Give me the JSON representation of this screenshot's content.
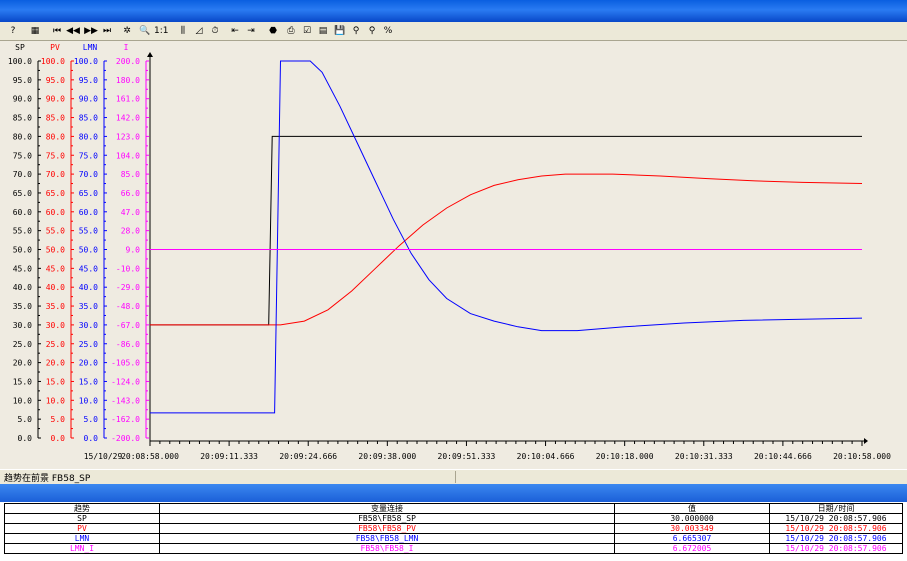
{
  "toolbar": {
    "buttons": [
      {
        "name": "help-button",
        "glyph": "?"
      },
      {
        "name": "properties-button",
        "glyph": "▦"
      },
      {
        "name": "first-button",
        "glyph": "⏮"
      },
      {
        "name": "prev-button",
        "glyph": "◀◀"
      },
      {
        "name": "next-button",
        "glyph": "▶▶"
      },
      {
        "name": "last-button",
        "glyph": "⏭"
      },
      {
        "name": "pause-button",
        "glyph": "✲"
      },
      {
        "name": "zoom-button",
        "glyph": "🔍"
      },
      {
        "name": "original-size-button",
        "glyph": "1:1"
      },
      {
        "name": "ruler-button",
        "glyph": "⫼"
      },
      {
        "name": "zoom-area-button",
        "glyph": "◿"
      },
      {
        "name": "reset-button",
        "glyph": "⏱"
      },
      {
        "name": "select-trend-button",
        "glyph": "⇤"
      },
      {
        "name": "export-button",
        "glyph": "⇥"
      },
      {
        "name": "start-button",
        "glyph": "⬣"
      },
      {
        "name": "print-button",
        "glyph": "⎙"
      },
      {
        "name": "config-button",
        "glyph": "☑"
      },
      {
        "name": "stats-button",
        "glyph": "▤"
      },
      {
        "name": "save-button",
        "glyph": "💾"
      },
      {
        "name": "connect-button",
        "glyph": "⚲"
      },
      {
        "name": "connect2-button",
        "glyph": "⚲"
      },
      {
        "name": "percent-button",
        "glyph": "%"
      }
    ]
  },
  "axes": {
    "headers": [
      "SP",
      "PV",
      "LMN",
      "I"
    ],
    "sp_ticks": [
      "100.0",
      "95.0",
      "90.0",
      "85.0",
      "80.0",
      "75.0",
      "70.0",
      "65.0",
      "60.0",
      "55.0",
      "50.0",
      "45.0",
      "40.0",
      "35.0",
      "30.0",
      "25.0",
      "20.0",
      "15.0",
      "10.0",
      "5.0",
      "0.0"
    ],
    "pv_ticks": [
      "100.0",
      "95.0",
      "90.0",
      "85.0",
      "80.0",
      "75.0",
      "70.0",
      "65.0",
      "60.0",
      "55.0",
      "50.0",
      "45.0",
      "40.0",
      "35.0",
      "30.0",
      "25.0",
      "20.0",
      "15.0",
      "10.0",
      "5.0",
      "0.0"
    ],
    "lmn_ticks": [
      "100.0",
      "95.0",
      "90.0",
      "85.0",
      "80.0",
      "75.0",
      "70.0",
      "65.0",
      "60.0",
      "55.0",
      "50.0",
      "45.0",
      "40.0",
      "35.0",
      "30.0",
      "25.0",
      "20.0",
      "15.0",
      "10.0",
      "5.0",
      "0.0"
    ],
    "i_ticks": [
      "200.0",
      "180.0",
      "161.0",
      "142.0",
      "123.0",
      "104.0",
      "85.0",
      "66.0",
      "47.0",
      "28.0",
      "9.0",
      "-10.0",
      "-29.0",
      "-48.0",
      "-67.0",
      "-86.0",
      "-105.0",
      "-124.0",
      "-143.0",
      "-162.0",
      "-200.0"
    ],
    "x_date": "15/10/29",
    "x_ticks": [
      "20:08:58.000",
      "20:09:11.333",
      "20:09:24.666",
      "20:09:38.000",
      "20:09:51.333",
      "20:10:04.666",
      "20:10:18.000",
      "20:10:31.333",
      "20:10:44.666",
      "20:10:58.000"
    ]
  },
  "colors": {
    "sp": "#000000",
    "pv": "#ff0000",
    "lmn": "#0000ff",
    "i": "#ff00ff"
  },
  "status": {
    "text": "趋势在前景 FB58_SP"
  },
  "table": {
    "headers": [
      "趋势",
      "变量连接",
      "值",
      "日期/时间"
    ],
    "rows": [
      {
        "trend": "SP",
        "var": "FB58\\FB58_SP",
        "value": "30.000000",
        "datetime": "15/10/29 20:08:57.906",
        "color": "#000000"
      },
      {
        "trend": "PV",
        "var": "FB58\\FB58_PV",
        "value": "30.003349",
        "datetime": "15/10/29 20:08:57.906",
        "color": "#ff0000"
      },
      {
        "trend": "LMN",
        "var": "FB58\\FB58_LMN",
        "value": "6.665307",
        "datetime": "15/10/29 20:08:57.906",
        "color": "#0000ff"
      },
      {
        "trend": "LMN_I",
        "var": "FB58\\FB58_I",
        "value": "6.672005",
        "datetime": "15/10/29 20:08:57.906",
        "color": "#ff00ff"
      }
    ]
  },
  "chart_data": {
    "type": "line",
    "x_unit": "seconds",
    "xlim": [
      0,
      120
    ],
    "series": [
      {
        "name": "SP",
        "axis": "sp",
        "points": [
          [
            0,
            30
          ],
          [
            20,
            30
          ],
          [
            20.6,
            80
          ],
          [
            120,
            80
          ]
        ]
      },
      {
        "name": "PV",
        "axis": "pv",
        "points": [
          [
            0,
            30
          ],
          [
            22,
            30
          ],
          [
            26,
            31
          ],
          [
            30,
            34
          ],
          [
            34,
            39
          ],
          [
            38,
            45
          ],
          [
            42,
            51
          ],
          [
            46,
            56.5
          ],
          [
            50,
            61
          ],
          [
            54,
            64.5
          ],
          [
            58,
            67
          ],
          [
            62,
            68.5
          ],
          [
            66,
            69.5
          ],
          [
            70,
            70
          ],
          [
            78,
            70
          ],
          [
            86,
            69.5
          ],
          [
            94,
            68.8
          ],
          [
            102,
            68.2
          ],
          [
            110,
            67.8
          ],
          [
            120,
            67.5
          ]
        ]
      },
      {
        "name": "LMN",
        "axis": "lmn",
        "points": [
          [
            0,
            6.67
          ],
          [
            21,
            6.67
          ],
          [
            22,
            100
          ],
          [
            27,
            100
          ],
          [
            29,
            97
          ],
          [
            32,
            88
          ],
          [
            35,
            78
          ],
          [
            38,
            68
          ],
          [
            41,
            58
          ],
          [
            44,
            49
          ],
          [
            47,
            42
          ],
          [
            50,
            37
          ],
          [
            54,
            33
          ],
          [
            58,
            31
          ],
          [
            62,
            29.5
          ],
          [
            66,
            28.5
          ],
          [
            72,
            28.5
          ],
          [
            80,
            29.5
          ],
          [
            90,
            30.5
          ],
          [
            100,
            31.2
          ],
          [
            120,
            31.8
          ]
        ]
      },
      {
        "name": "LMN_I",
        "axis": "i",
        "points": [
          [
            0,
            9
          ],
          [
            120,
            9
          ]
        ]
      }
    ]
  }
}
